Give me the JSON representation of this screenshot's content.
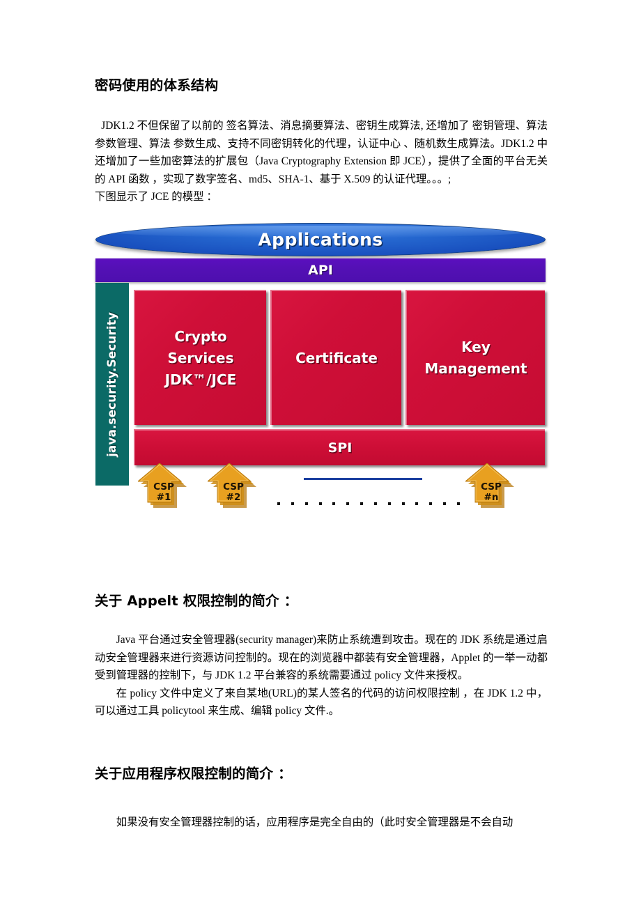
{
  "document": {
    "heading_1": "密码使用的体系结构",
    "paragraph_1_a": "JDK1.2  不但保留了以前的  签名算法、消息摘要算法、密钥生成算法, 还增加了  密钥管理、算法参数管理、算法  参数生成、支持不同密钥转化的代理，认证中心  、随机数生成算法。JDK1.2 中还增加了一些加密算法的扩展包（Java Cryptography Extension 即 JCE），提供了全面的平台无关的 API  函数  ，实现了数字签名、md5、SHA-1、基于 X.509  的认证代理。。。;",
    "paragraph_1_b": "下图显示了 JCE 的模型 ：",
    "heading_2": "关于 Appelt 权限控制的简介 ：",
    "paragraph_2_a": "Java 平台通过安全管理器(security manager)来防止系统遭到攻击。现在的 JDK  系统是通过启动安全管理器来进行资源访问控制的。现在的浏览器中都装有安全管理器，Applet 的一举一动都受到管理器的控制下，与 JDK 1.2  平台兼容的系统需要通过  policy  文件来授权。",
    "paragraph_2_b": "在 policy   文件中定义了来自某地(URL)的某人签名的代码的访问权限控制  ，在 JDK 1.2 中，可以通过工具 policytool 来生成、编辑 policy 文件.。",
    "heading_3": "关于应用程序权限控制的简介 ：",
    "paragraph_3": "如果没有安全管理器控制的话，应用程序是完全自由的（此时安全管理器是不会自动"
  },
  "figure": {
    "applications_label": "Applications",
    "api_label": "API",
    "sidebar_label": "java.security.Security",
    "spi_label": "SPI",
    "boxes": [
      {
        "lines": [
          "Crypto",
          "Services",
          "JDK™/JCE"
        ]
      },
      {
        "lines": [
          "Certificate"
        ]
      },
      {
        "lines": [
          "Key",
          "Management"
        ]
      }
    ],
    "providers": [
      {
        "line1": "CSP",
        "line2": "#1"
      },
      {
        "line1": "CSP",
        "line2": "#2"
      },
      {
        "line1": "CSP",
        "line2": "#n"
      }
    ],
    "dot_count": 14,
    "colors": {
      "applications_fill": "#1447b8",
      "api_fill": "#5410b5",
      "sidebar_fill": "#0b6a66",
      "box_fill": "#cf0f38",
      "provider_fill": "#e8a020",
      "accent_blue_strip": "#1b3fa0"
    }
  }
}
